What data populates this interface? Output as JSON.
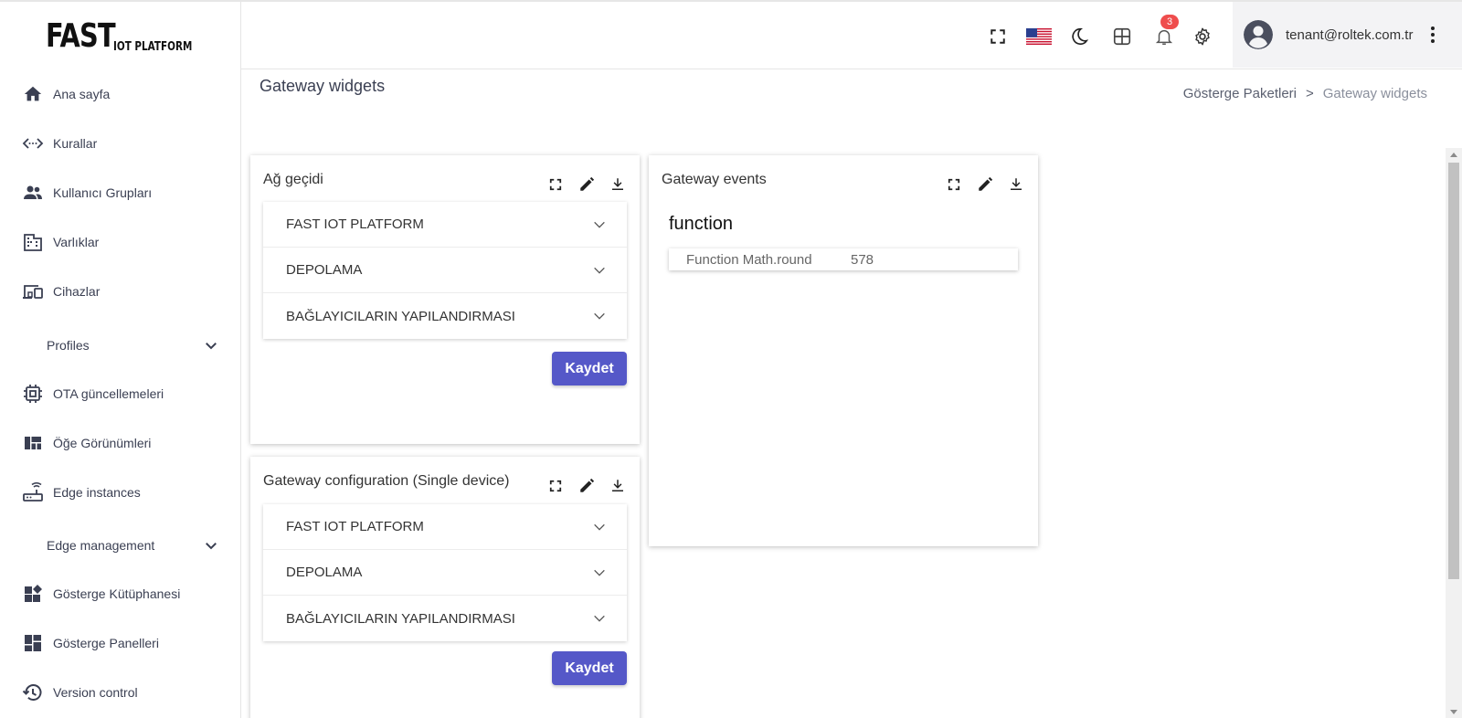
{
  "logo": {
    "big": "FAST",
    "small": "IOT PLATFORM"
  },
  "sidebar": {
    "items": [
      {
        "label": "Ana sayfa",
        "icon": "home-icon"
      },
      {
        "label": "Kurallar",
        "icon": "code-arrows-icon"
      },
      {
        "label": "Kullanıcı Grupları",
        "icon": "user-group-icon"
      },
      {
        "label": "Varlıklar",
        "icon": "building-icon"
      },
      {
        "label": "Cihazlar",
        "icon": "devices-icon"
      },
      {
        "label": "Profiles",
        "icon": "chevron-down-icon",
        "group": true
      },
      {
        "label": "OTA güncellemeleri",
        "icon": "chip-icon"
      },
      {
        "label": "Öğe Görünümleri",
        "icon": "view-quilt-icon"
      },
      {
        "label": "Edge instances",
        "icon": "router-icon"
      },
      {
        "label": "Edge management",
        "icon": "chevron-down-icon",
        "group": true
      },
      {
        "label": "Gösterge Kütüphanesi",
        "icon": "widgets-icon"
      },
      {
        "label": "Gösterge Panelleri",
        "icon": "dashboard-icon"
      },
      {
        "label": "Version control",
        "icon": "history-icon"
      }
    ]
  },
  "header": {
    "notifications_count": "3",
    "user_email": "tenant@roltek.com.tr",
    "badge_color": "#ef4d4d"
  },
  "page": {
    "title": "Gateway widgets",
    "breadcrumb": {
      "parent": "Gösterge Paketleri",
      "separator": ">",
      "current": "Gateway widgets"
    }
  },
  "widgets": {
    "ag_gecidi": {
      "title": "Ağ geçidi",
      "sections": [
        "FAST IOT PLATFORM",
        "DEPOLAMA",
        "BAĞLAYICILARIN YAPILANDIRMASI"
      ],
      "save_label": "Kaydet"
    },
    "gateway_config": {
      "title": "Gateway configuration (Single device)",
      "sections": [
        "FAST IOT PLATFORM",
        "DEPOLAMA",
        "BAĞLAYICILARIN YAPILANDIRMASI"
      ],
      "save_label": "Kaydet"
    },
    "gateway_events": {
      "title": "Gateway events",
      "heading": "function",
      "row_key": "Function Math.round",
      "row_value": "578"
    }
  },
  "colors": {
    "accent": "#5558c8",
    "text": "#3a3f52"
  }
}
